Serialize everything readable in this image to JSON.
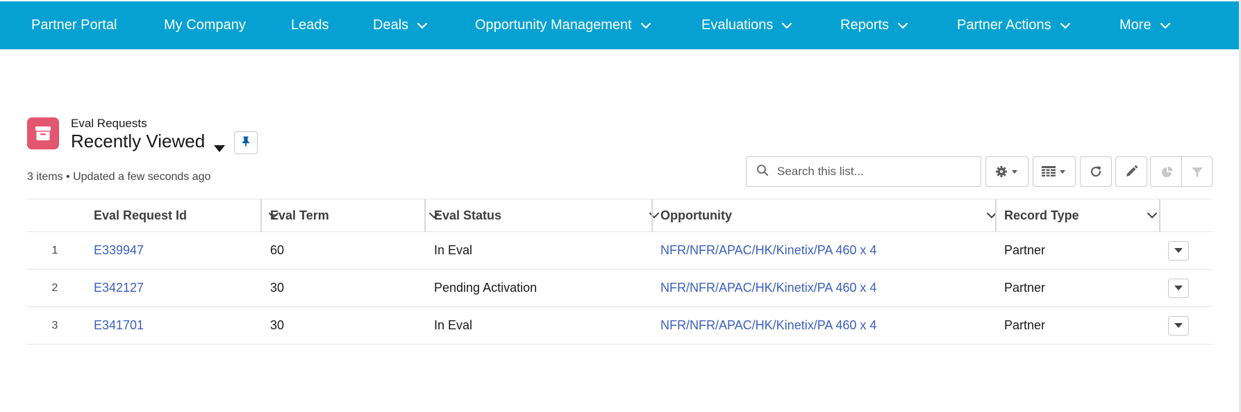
{
  "nav": {
    "items": [
      {
        "label": "Partner Portal",
        "dropdown": false
      },
      {
        "label": "My Company",
        "dropdown": false
      },
      {
        "label": "Leads",
        "dropdown": false
      },
      {
        "label": "Deals",
        "dropdown": true
      },
      {
        "label": "Opportunity Management",
        "dropdown": true
      },
      {
        "label": "Evaluations",
        "dropdown": true
      },
      {
        "label": "Reports",
        "dropdown": true
      },
      {
        "label": "Partner Actions",
        "dropdown": true
      },
      {
        "label": "More",
        "dropdown": true
      }
    ]
  },
  "list": {
    "object_label": "Eval Requests",
    "view_name": "Recently Viewed",
    "meta": "3 items • Updated a few seconds ago",
    "object_icon": "archive-box-icon"
  },
  "toolbar": {
    "search_placeholder": "Search this list...",
    "buttons": [
      "settings-gear-icon",
      "table-view-icon",
      "refresh-icon",
      "edit-pencil-icon",
      "chart-pie-icon",
      "filter-funnel-icon"
    ]
  },
  "table": {
    "columns": [
      "Eval Request Id",
      "Eval Term",
      "Eval Status",
      "Opportunity",
      "Record Type"
    ],
    "rows": [
      {
        "num": "1",
        "id": "E339947",
        "term": "60",
        "status": "In Eval",
        "opportunity": "NFR/NFR/APAC/HK/Kinetix/PA 460 x 4",
        "record_type": "Partner"
      },
      {
        "num": "2",
        "id": "E342127",
        "term": "30",
        "status": "Pending Activation",
        "opportunity": "NFR/NFR/APAC/HK/Kinetix/PA 460 x 4",
        "record_type": "Partner"
      },
      {
        "num": "3",
        "id": "E341701",
        "term": "30",
        "status": "In Eval",
        "opportunity": "NFR/NFR/APAC/HK/Kinetix/PA 460 x 4",
        "record_type": "Partner"
      }
    ]
  },
  "colors": {
    "nav_bg": "#05a1d2",
    "object_icon_bg": "#e3566f",
    "link": "#3b5fbf"
  }
}
